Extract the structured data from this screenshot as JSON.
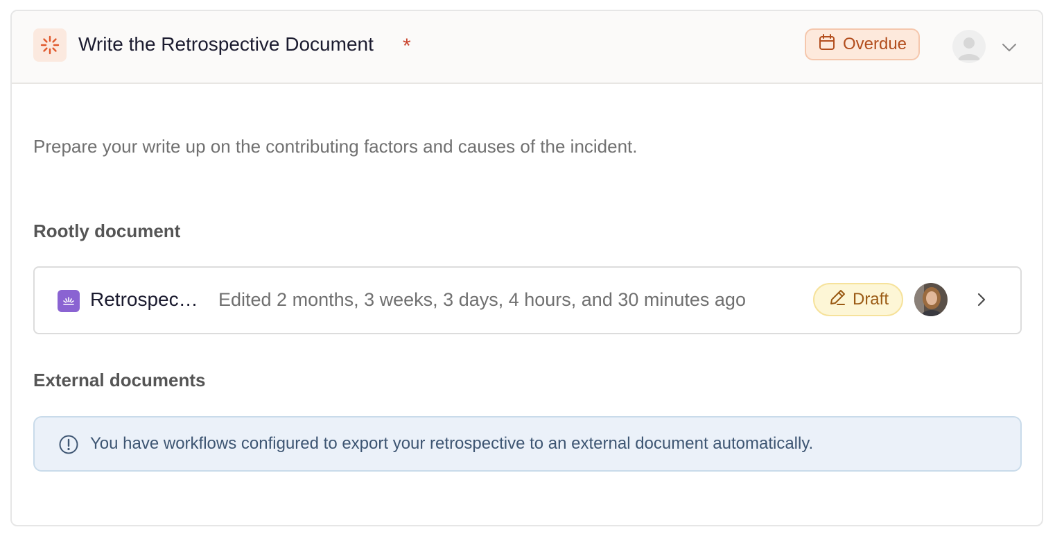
{
  "task": {
    "title": "Write the Retrospective Document",
    "required_marker": "*",
    "status_badge": "Overdue",
    "description": "Prepare your write up on the contributing factors and causes of the incident."
  },
  "rootly_section": {
    "heading": "Rootly document",
    "document": {
      "title": "Retrospective",
      "edited": "Edited 2 months, 3 weeks, 3 days, 4 hours, and 30 minutes ago",
      "status": "Draft"
    }
  },
  "external_section": {
    "heading": "External documents",
    "notice": "You have workflows configured to export your retrospective to an external document automatically."
  },
  "colors": {
    "overdue": "#b24d1d",
    "draft": "#9a5a14",
    "doc_icon": "#8a63d2",
    "info": "#3d5572"
  },
  "icons": [
    "spinner-icon",
    "calendar-icon",
    "user-avatar",
    "chevron-down-icon",
    "rootly-doc-icon",
    "pencil-icon",
    "author-avatar",
    "chevron-right-icon",
    "info-icon"
  ]
}
